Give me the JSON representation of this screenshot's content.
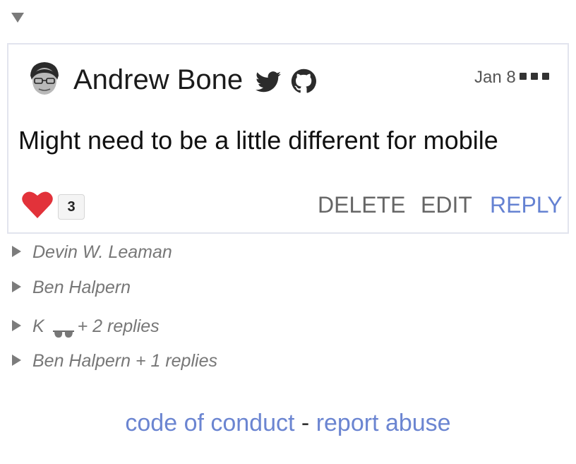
{
  "comment": {
    "author": "Andrew Bone",
    "date": "Jan 8",
    "body": "Might need to be a little different for mobile",
    "reaction_count": "3",
    "actions": {
      "delete": "DELETE",
      "edit": "EDIT",
      "reply": "REPLY"
    },
    "icons": {
      "social": [
        "twitter-icon",
        "github-icon"
      ],
      "menu": "more-options-icon",
      "reaction": "heart-icon",
      "toggle": "collapse-triangle-icon"
    }
  },
  "threads": [
    {
      "author": "Devin W. Leaman",
      "suffix": ""
    },
    {
      "author": "Ben Halpern",
      "suffix": ""
    },
    {
      "author": "K",
      "suffix": "+ 2 replies",
      "emoji": "glasses-icon"
    },
    {
      "author": "Ben Halpern",
      "suffix": "+ 1 replies"
    }
  ],
  "footer": {
    "code_of_conduct": "code of conduct",
    "separator": "-",
    "report_abuse": "report abuse"
  },
  "colors": {
    "link": "#6b85d1",
    "reply": "#6582d2",
    "heart": "#e2323a",
    "muted_text": "#777777",
    "card_border": "#e2e4ee"
  }
}
